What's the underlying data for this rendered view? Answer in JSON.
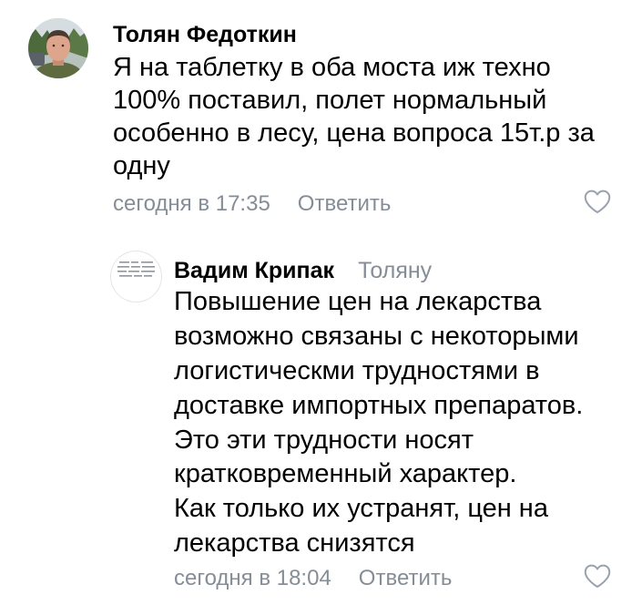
{
  "comment": {
    "author": "Толян Федоткин",
    "avatar_icon": "user-photo-avatar",
    "text_lines": [
      "Я на таблетку в оба моста иж техно",
      "100% поставил, полет нормальный",
      "особенно в лесу, цена вопроса 15т.р за",
      "одну"
    ],
    "timestamp": "сегодня в 17:35",
    "reply_label": "Ответить",
    "like_icon": "heart-outline-icon"
  },
  "reply": {
    "author": "Вадим Крипак",
    "avatar_icon": "logo-avatar",
    "reply_to": "Толяну",
    "text_lines": [
      "Повышение цен на лекарства",
      "возможно связаны с некоторыми",
      "логистическми трудностями в",
      "доставке импортных препаратов.",
      "Это эти трудности носят",
      "кратковременный характер.",
      "Как только их устранят, цен на",
      "лекарства снизятся"
    ],
    "timestamp": "сегодня в 18:04",
    "reply_label": "Ответить",
    "like_icon": "heart-outline-icon"
  },
  "colors": {
    "background": "#ffffff",
    "primary_text": "#000000",
    "secondary_text": "#858d96",
    "icon": "#99a2ad"
  }
}
